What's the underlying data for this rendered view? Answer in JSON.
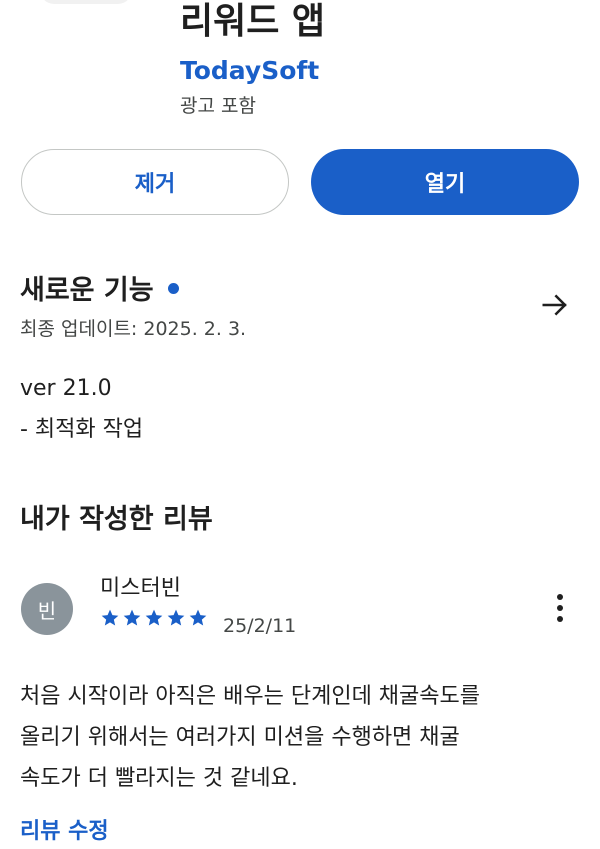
{
  "app": {
    "title": "리워드 앱",
    "developer": "TodaySoft",
    "ad_label": "광고 포함"
  },
  "buttons": {
    "remove": "제거",
    "open": "열기"
  },
  "whats_new": {
    "title": "새로운 기능",
    "updated": "최종 업데이트: 2025. 2. 3.",
    "version": "ver 21.0",
    "note": "- 최적화 작업"
  },
  "my_review": {
    "section_title": "내가 작성한 리뷰",
    "avatar_initial": "빈",
    "reviewer_name": "미스터빈",
    "rating": 5,
    "date": "25/2/11",
    "text_lines": [
      "처음 시작이라 아직은 배우는 단계인데 채굴속도를",
      "올리기 위해서는 여러가지 미션을 수행하면 채굴",
      "속도가 더 빨라지는 것 같네요."
    ],
    "edit_label": "리뷰 수정"
  },
  "colors": {
    "accent": "#1a5fc8",
    "avatar_bg": "#8a949b",
    "text_primary": "#1f1f1f",
    "text_secondary": "#444746",
    "outline": "#c4c7c5"
  },
  "icons": {
    "arrow": "arrow-right-icon",
    "more": "more-vertical-icon",
    "star": "star-icon",
    "new_dot": "new-dot-icon"
  }
}
